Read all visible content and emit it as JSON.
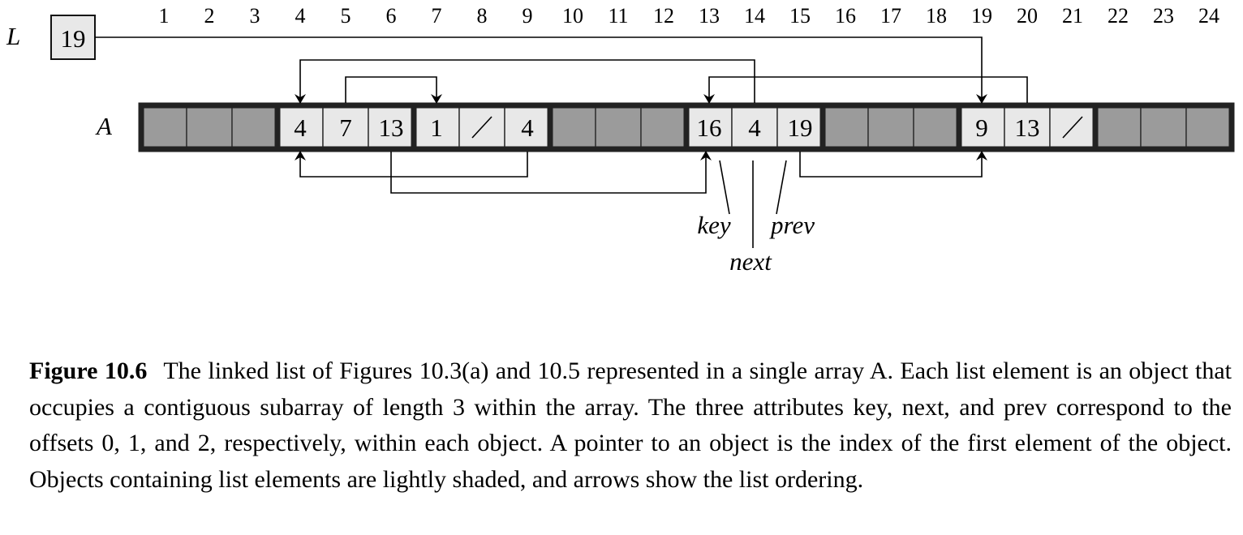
{
  "diagram": {
    "list_head_label": "L",
    "list_head_value": "19",
    "array_label": "A",
    "indices": [
      "1",
      "2",
      "3",
      "4",
      "5",
      "6",
      "7",
      "8",
      "9",
      "10",
      "11",
      "12",
      "13",
      "14",
      "15",
      "16",
      "17",
      "18",
      "19",
      "20",
      "21",
      "22",
      "23",
      "24"
    ],
    "cells": [
      "",
      "",
      "",
      "4",
      "7",
      "13",
      "1",
      "/",
      "4",
      "",
      "",
      "",
      "16",
      "4",
      "19",
      "",
      "",
      "",
      "9",
      "13",
      "/",
      "",
      "",
      ""
    ],
    "objects": [
      {
        "start": 4,
        "key": "4",
        "next": "7",
        "prev": "13"
      },
      {
        "start": 7,
        "key": "1",
        "next": "/",
        "prev": "4"
      },
      {
        "start": 13,
        "key": "16",
        "next": "4",
        "prev": "19"
      },
      {
        "start": 19,
        "key": "9",
        "next": "13",
        "prev": "/"
      }
    ],
    "attribute_labels": {
      "key": "key",
      "next": "next",
      "prev": "prev"
    },
    "colors": {
      "free_cell": "#9b9b9b",
      "used_cell": "#e8e8e8",
      "border": "#222222"
    }
  },
  "caption": {
    "label": "Figure 10.6",
    "text": "The linked list of Figures 10.3(a) and 10.5 represented in a single array A. Each list element is an object that occupies a contiguous subarray of length 3 within the array. The three attributes key, next, and prev correspond to the offsets 0, 1, and 2, respectively, within each object. A pointer to an object is the index of the first element of the object. Objects containing list elements are lightly shaded, and arrows show the list ordering."
  }
}
